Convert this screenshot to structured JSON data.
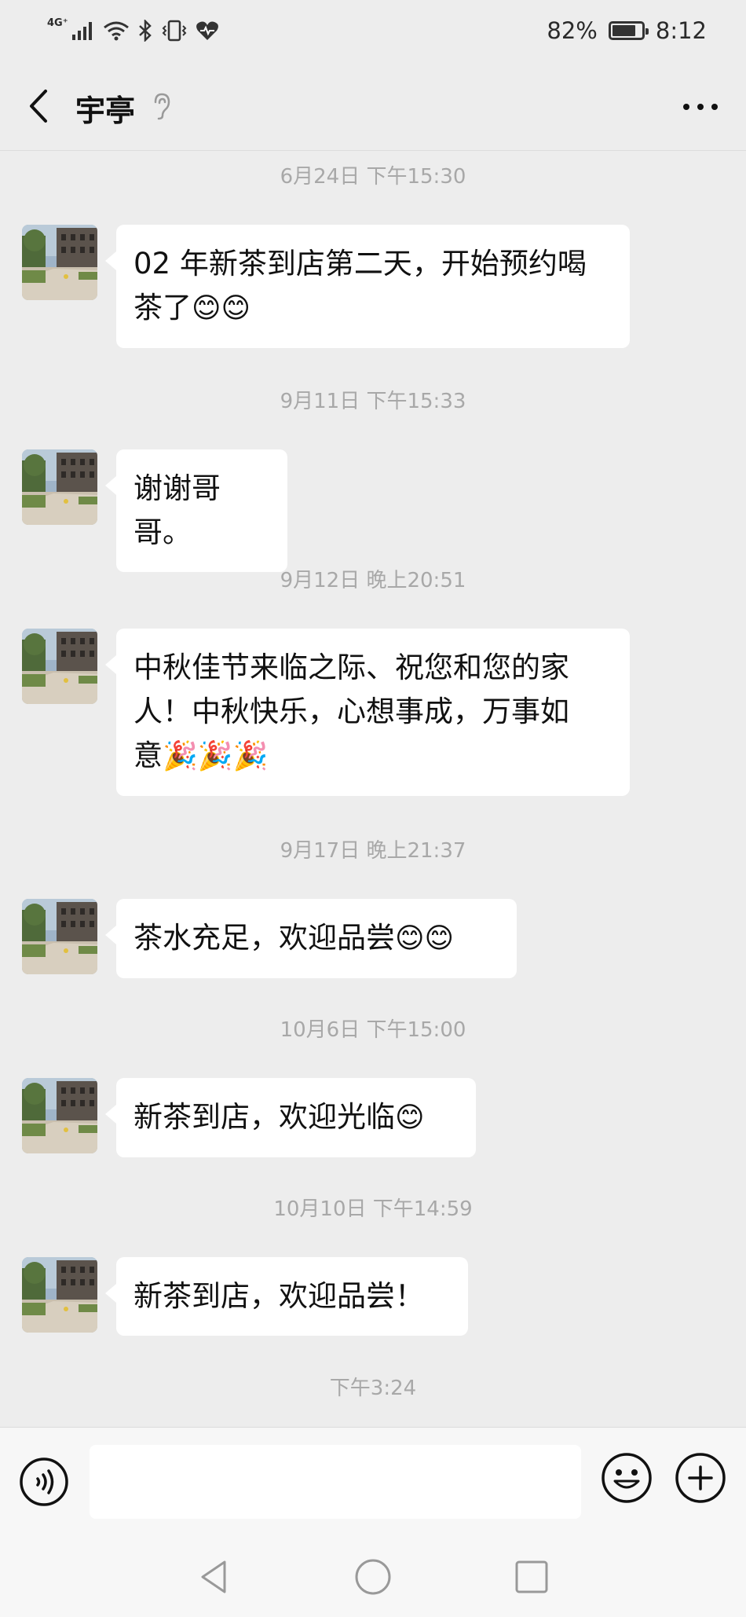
{
  "status_bar": {
    "network": "4G⁺",
    "battery_text": "82%",
    "battery_level": 0.82,
    "time": "8:12"
  },
  "header": {
    "contact_name": "宇亭"
  },
  "messages": [
    {
      "time": "6月24日 下午15:30",
      "text": "02 年新茶到店第二天，开始预约喝\n茶了",
      "emoji": "😊😊"
    },
    {
      "time": "9月11日 下午15:33",
      "text": "谢谢哥哥。",
      "emoji": ""
    },
    {
      "time": "9月12日 晚上20:51",
      "text": "中秋佳节来临之际、祝您和您的家\n人！中秋快乐，心想事成，万事如\n意",
      "emoji": "🎉🎉🎉"
    },
    {
      "time": "9月17日 晚上21:37",
      "text": "茶水充足，欢迎品尝",
      "emoji": "😊😊"
    },
    {
      "time": "10月6日 下午15:00",
      "text": "新茶到店，欢迎光临",
      "emoji": "😊"
    },
    {
      "time": "10月10日 下午14:59",
      "text": "新茶到店，欢迎品尝！",
      "emoji": ""
    }
  ],
  "last_time": "下午3:24",
  "input": {
    "value": "",
    "placeholder": ""
  },
  "colors": {
    "background": "#ededed",
    "bubble": "#ffffff",
    "timestamp": "#a8a8a8"
  }
}
